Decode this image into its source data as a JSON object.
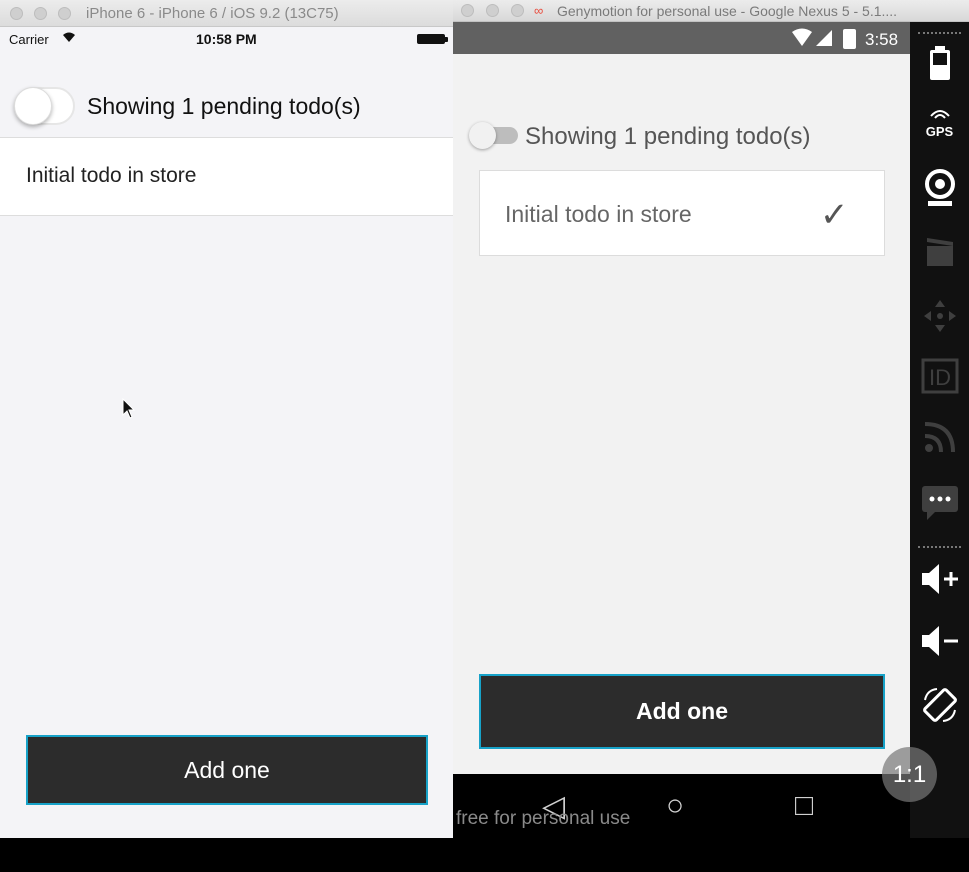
{
  "ios": {
    "window_title": "iPhone 6 - iPhone 6 / iOS 9.2 (13C75)",
    "status": {
      "carrier": "Carrier",
      "time": "10:58 PM"
    },
    "toggle_on": false,
    "pending_text": "Showing 1 pending todo(s)",
    "todos": [
      {
        "text": "Initial todo in store"
      }
    ],
    "add_button": "Add one"
  },
  "android": {
    "window_title": "Genymotion for personal use - Google Nexus 5 - 5.1....",
    "status": {
      "time": "3:58"
    },
    "toggle_on": false,
    "pending_text": "Showing 1 pending todo(s)",
    "todos": [
      {
        "text": "Initial todo in store",
        "check": "✓"
      }
    ],
    "add_button": "Add one",
    "watermark": "free for personal use",
    "nav": {
      "back": "◁",
      "home": "○",
      "recents": "□"
    }
  },
  "toolbar": {
    "gps_label": "GPS",
    "id_label": "ID",
    "fab_label": "1:1"
  },
  "colors": {
    "button_bg": "#2c2c2c",
    "button_border": "#17a2c8",
    "android_statusbar": "#616161"
  }
}
